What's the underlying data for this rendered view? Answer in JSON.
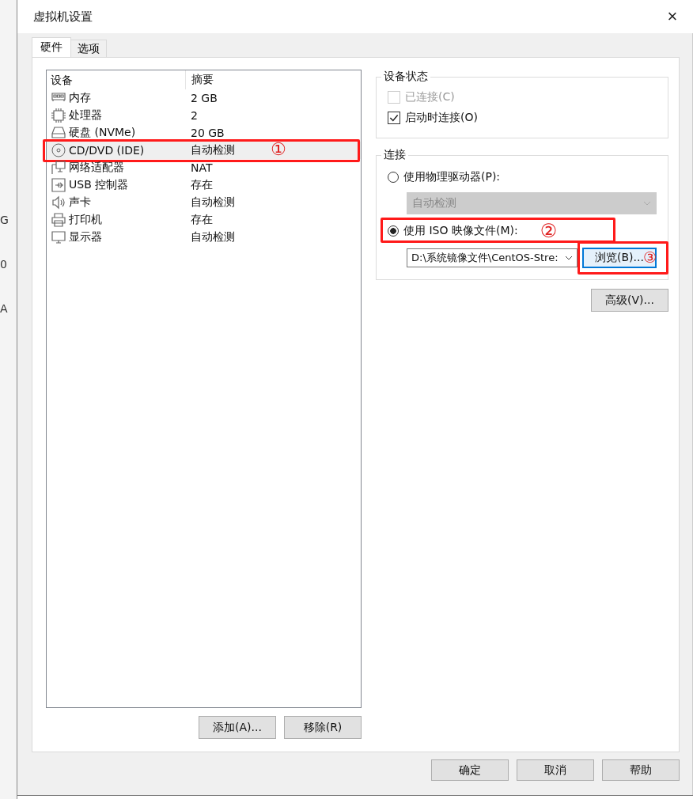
{
  "background_window": {
    "fragments": [
      "G",
      "0",
      "A"
    ]
  },
  "window": {
    "title": "虚拟机设置",
    "close": "×"
  },
  "tabs": [
    {
      "label": "硬件",
      "selected": true
    },
    {
      "label": "选项",
      "selected": false
    }
  ],
  "device_list": {
    "columns": [
      "设备",
      "摘要"
    ],
    "rows": [
      {
        "kind": "memory",
        "device": "内存",
        "summary": "2 GB",
        "selected": false
      },
      {
        "kind": "cpu",
        "device": "处理器",
        "summary": "2",
        "selected": false
      },
      {
        "kind": "disk",
        "device": "硬盘 (NVMe)",
        "summary": "20 GB",
        "selected": false
      },
      {
        "kind": "cd",
        "device": "CD/DVD (IDE)",
        "summary": "自动检测",
        "selected": true,
        "annotation": "①"
      },
      {
        "kind": "network",
        "device": "网络适配器",
        "summary": "NAT",
        "selected": false
      },
      {
        "kind": "usb",
        "device": "USB 控制器",
        "summary": "存在",
        "selected": false
      },
      {
        "kind": "sound",
        "device": "声卡",
        "summary": "自动检测",
        "selected": false
      },
      {
        "kind": "printer",
        "device": "打印机",
        "summary": "存在",
        "selected": false
      },
      {
        "kind": "display",
        "device": "显示器",
        "summary": "自动检测",
        "selected": false
      }
    ]
  },
  "list_buttons": [
    "添加(A)...",
    "移除(R)"
  ],
  "device_status": {
    "title": "设备状态",
    "options": [
      {
        "label": "已连接(C)",
        "checked": false,
        "disabled": true
      },
      {
        "label": "启动时连接(O)",
        "checked": true,
        "disabled": false
      }
    ]
  },
  "connection": {
    "title": "连接",
    "physical": {
      "label": "使用物理驱动器(P):",
      "selected": false,
      "dropdown": "自动检测",
      "disabled": true
    },
    "iso": {
      "label": "使用 ISO 映像文件(M):",
      "selected": true,
      "annotation": "②",
      "path": "D:\\系统镜像文件\\CentOS-Stre:",
      "browse": "浏览(B)...",
      "browse_annotation": "③"
    }
  },
  "advanced_button": "高级(V)...",
  "dialog_buttons": [
    "确定",
    "取消",
    "帮助"
  ]
}
